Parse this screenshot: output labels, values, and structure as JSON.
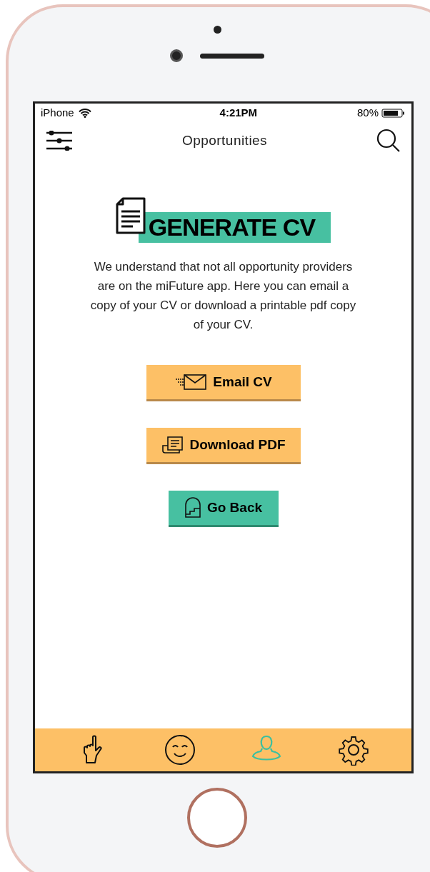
{
  "status_bar": {
    "carrier": "iPhone",
    "time": "4:21PM",
    "battery": "80%"
  },
  "header": {
    "title": "Opportunities"
  },
  "banner": {
    "title": "GENERATE CV"
  },
  "description": "We understand that not all opportunity providers are on the miFuture app. Here you can email a copy of your CV or download a printable pdf copy of your CV.",
  "buttons": [
    {
      "kind": "email",
      "label": "Email CV"
    },
    {
      "kind": "pdf",
      "label": "Download PDF"
    },
    {
      "kind": "back",
      "label": "Go Back"
    }
  ],
  "tab_bar": [
    {
      "kind": "hand",
      "selected": false
    },
    {
      "kind": "smiley",
      "selected": false
    },
    {
      "kind": "profile",
      "selected": true
    },
    {
      "kind": "settings",
      "selected": false
    }
  ]
}
